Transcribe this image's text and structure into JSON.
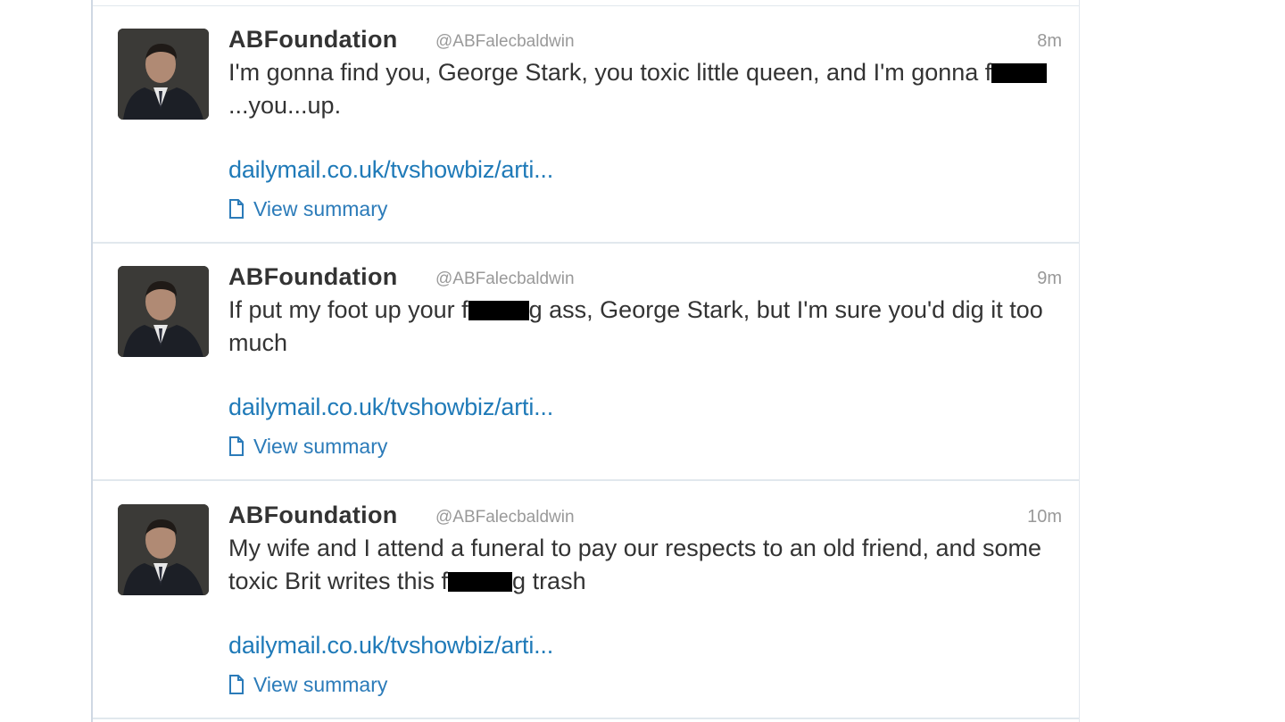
{
  "tweets": [
    {
      "name": "ABFoundation",
      "handle": "@ABFalecbaldwin",
      "time": "8m",
      "text_segments": [
        "I'm gonna find you, George Stark, you toxic little queen, and I'm gonna f",
        "...you...up."
      ],
      "redaction_widths": [
        62
      ],
      "link": "dailymail.co.uk/tvshowbiz/arti...",
      "summary": "View summary"
    },
    {
      "name": "ABFoundation",
      "handle": "@ABFalecbaldwin",
      "time": "9m",
      "text_segments": [
        "If put my foot up your f",
        "g ass, George Stark, but I'm sure you'd dig it too much"
      ],
      "redaction_widths": [
        68
      ],
      "link": "dailymail.co.uk/tvshowbiz/arti...",
      "summary": "View summary"
    },
    {
      "name": "ABFoundation",
      "handle": "@ABFalecbaldwin",
      "time": "10m",
      "text_segments": [
        "My wife and I attend a funeral to pay our respects to an old friend, and some toxic Brit writes this f",
        "g trash"
      ],
      "redaction_widths": [
        72
      ],
      "link": "dailymail.co.uk/tvshowbiz/arti...",
      "summary": "View summary"
    }
  ],
  "colors": {
    "name": "#333333",
    "meta": "#999999",
    "link": "#1f7ab8",
    "divider": "#e1e8ed"
  },
  "icons": {
    "summary": "document-icon",
    "avatar": "profile-photo"
  }
}
